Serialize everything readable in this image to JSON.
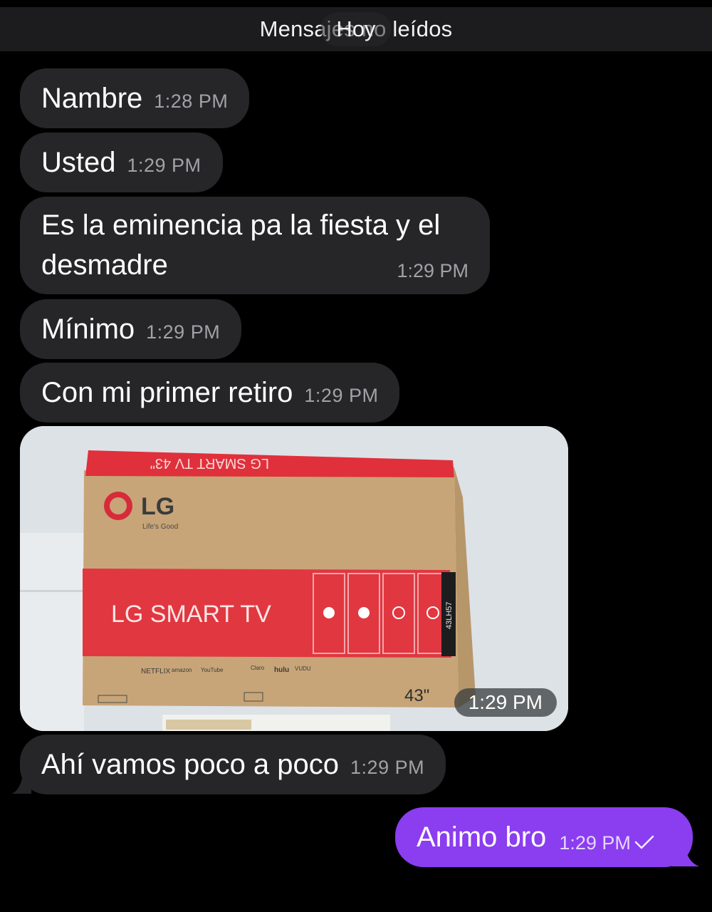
{
  "header": {
    "unread_label": "Mensajes no leídos",
    "date_pill": "Hoy"
  },
  "messages": [
    {
      "text": "Nambre",
      "time": "1:28 PM"
    },
    {
      "text": "Usted",
      "time": "1:29 PM"
    },
    {
      "text": "Es la eminencia pa la fiesta y el desmadre",
      "time": "1:29 PM"
    },
    {
      "text": "Mínimo",
      "time": "1:29 PM"
    },
    {
      "text": "Con mi primer retiro",
      "time": "1:29 PM"
    },
    {
      "text": "Ahí vamos poco a poco",
      "time": "1:29 PM"
    }
  ],
  "photo": {
    "time": "1:29 PM",
    "box": {
      "brand": "LG",
      "tagline": "Life's Good",
      "product": "LG SMART TV",
      "top_flap": "LG SMART TV 43\"",
      "size": "43\"",
      "model": "43LH57",
      "apps": [
        "NETFLIX",
        "amazon",
        "YouTube",
        "Claro",
        "hulu",
        "VUDU"
      ]
    }
  },
  "outgoing": {
    "text": "Animo bro",
    "time": "1:29 PM",
    "status_icon": "check-icon"
  },
  "colors": {
    "incoming_bubble": "#262628",
    "outgoing_bubble": "#8b3df0",
    "background": "#000000"
  }
}
